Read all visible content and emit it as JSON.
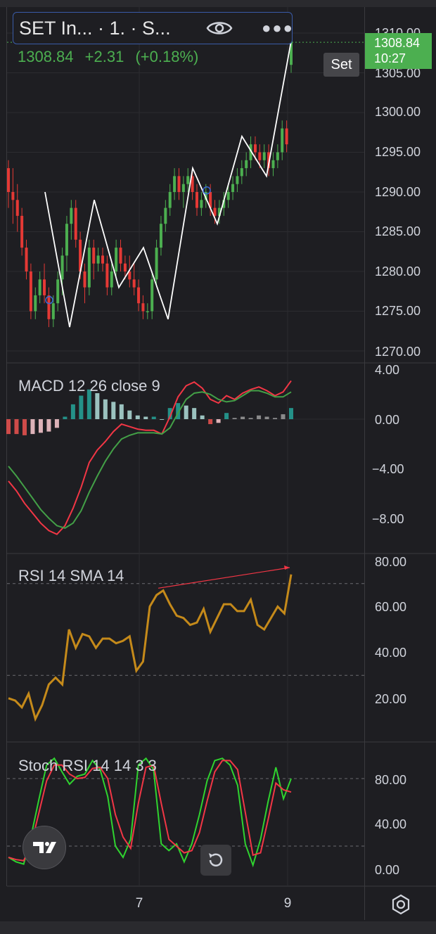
{
  "header": {
    "symbol_title": "SET In... · 1. · S...",
    "eye_icon": "eye-icon",
    "more_icon": "more-dots-icon"
  },
  "quote": {
    "last": "1308.84",
    "change": "+2.31",
    "change_pct": "(+0.18%)"
  },
  "price_tag": {
    "price": "1308.84",
    "countdown": "10:27"
  },
  "set_button": "Set",
  "price_axis": [
    "1310.00",
    "1305.00",
    "1300.00",
    "1295.00",
    "1290.00",
    "1285.00",
    "1280.00",
    "1275.00",
    "1270.00"
  ],
  "macd": {
    "label": "MACD 12 26 close 9",
    "axis": [
      "4.00",
      "0.00",
      "−4.00",
      "−8.00"
    ]
  },
  "rsi": {
    "label": "RSI 14 SMA 14",
    "axis": [
      "80.00",
      "60.00",
      "40.00",
      "20.00"
    ]
  },
  "stoch": {
    "label": "Stoch RSI 14 14 3 3",
    "axis": [
      "80.00",
      "40.00",
      "0.00"
    ]
  },
  "time_axis": [
    "7",
    "9"
  ],
  "colors": {
    "background": "#1e1e22",
    "up": "#4caf50",
    "down": "#e53935",
    "macd_line": "#f23645",
    "signal_line": "#43a047",
    "rsi_line": "#c58a1a",
    "stoch_k": "#2fd32f",
    "stoch_d": "#f23645",
    "zigzag": "#ffffff",
    "header_border": "#3a5ba8"
  },
  "icons": {
    "logo": "tradingview-logo-icon",
    "reset": "reset-chart-icon",
    "settings": "gear-icon"
  },
  "chart_data": [
    {
      "type": "candlestick",
      "title": "SET Index",
      "ylim": [
        1268,
        1313
      ],
      "y_ticks": [
        1270,
        1275,
        1280,
        1285,
        1290,
        1295,
        1300,
        1305,
        1310
      ],
      "x_ticks": [
        "7",
        "9"
      ],
      "zigzag": [
        1290,
        1273,
        1289,
        1278,
        1283,
        1274,
        1293,
        1286,
        1297,
        1292,
        1309
      ],
      "last_price": 1308.84,
      "candles": [
        [
          1293,
          1294,
          1288,
          1290
        ],
        [
          1290,
          1293,
          1286,
          1289
        ],
        [
          1289,
          1291,
          1285,
          1287
        ],
        [
          1287,
          1288,
          1282,
          1283
        ],
        [
          1283,
          1284,
          1279,
          1280
        ],
        [
          1280,
          1281,
          1274,
          1275
        ],
        [
          1275,
          1278,
          1274,
          1277
        ],
        [
          1277,
          1280,
          1276,
          1279
        ],
        [
          1279,
          1281,
          1276,
          1277
        ],
        [
          1277,
          1278,
          1273,
          1274
        ],
        [
          1274,
          1277,
          1273,
          1276
        ],
        [
          1276,
          1280,
          1275,
          1279
        ],
        [
          1279,
          1283,
          1277,
          1282
        ],
        [
          1282,
          1287,
          1280,
          1286
        ],
        [
          1286,
          1289,
          1284,
          1288
        ],
        [
          1288,
          1289,
          1283,
          1284
        ],
        [
          1284,
          1285,
          1279,
          1280
        ],
        [
          1280,
          1281,
          1276,
          1278
        ],
        [
          1278,
          1284,
          1277,
          1283
        ],
        [
          1283,
          1284,
          1279,
          1281
        ],
        [
          1281,
          1283,
          1280,
          1282
        ],
        [
          1282,
          1283,
          1280,
          1281
        ],
        [
          1281,
          1282,
          1277,
          1278
        ],
        [
          1278,
          1281,
          1277,
          1280
        ],
        [
          1280,
          1284,
          1279,
          1283
        ],
        [
          1283,
          1284,
          1280,
          1281
        ],
        [
          1281,
          1282,
          1279,
          1280
        ],
        [
          1280,
          1282,
          1278,
          1279
        ],
        [
          1279,
          1281,
          1277,
          1278
        ],
        [
          1278,
          1279,
          1275,
          1276
        ],
        [
          1276,
          1277,
          1274,
          1275
        ],
        [
          1275,
          1276,
          1274,
          1275
        ],
        [
          1275,
          1280,
          1274,
          1279
        ],
        [
          1279,
          1284,
          1278,
          1283
        ],
        [
          1283,
          1287,
          1282,
          1286
        ],
        [
          1286,
          1289,
          1285,
          1288
        ],
        [
          1288,
          1291,
          1287,
          1290
        ],
        [
          1290,
          1293,
          1289,
          1292
        ],
        [
          1292,
          1293,
          1289,
          1290
        ],
        [
          1290,
          1292,
          1288,
          1291
        ],
        [
          1291,
          1293,
          1290,
          1292
        ],
        [
          1292,
          1293,
          1289,
          1290
        ],
        [
          1290,
          1291,
          1287,
          1288
        ],
        [
          1288,
          1290,
          1287,
          1289
        ],
        [
          1289,
          1291,
          1288,
          1290
        ],
        [
          1290,
          1291,
          1287,
          1288
        ],
        [
          1288,
          1289,
          1286,
          1287
        ],
        [
          1287,
          1289,
          1286,
          1288
        ],
        [
          1288,
          1290,
          1287,
          1289
        ],
        [
          1289,
          1291,
          1288,
          1290
        ],
        [
          1290,
          1292,
          1289,
          1291
        ],
        [
          1291,
          1293,
          1290,
          1292
        ],
        [
          1292,
          1294,
          1291,
          1293
        ],
        [
          1293,
          1295,
          1292,
          1294
        ],
        [
          1294,
          1297,
          1293,
          1296
        ],
        [
          1296,
          1297,
          1294,
          1295
        ],
        [
          1295,
          1296,
          1293,
          1294
        ],
        [
          1294,
          1296,
          1293,
          1295
        ],
        [
          1295,
          1296,
          1292,
          1293
        ],
        [
          1293,
          1295,
          1292,
          1294
        ],
        [
          1294,
          1296,
          1293,
          1295
        ],
        [
          1295,
          1299,
          1294,
          1298
        ],
        [
          1298,
          1299,
          1295,
          1296
        ],
        [
          1306,
          1310,
          1305,
          1309
        ]
      ]
    },
    {
      "type": "line",
      "title": "MACD 12 26 close 9",
      "ylim": [
        -10.5,
        5.5
      ],
      "series": [
        {
          "name": "MACD",
          "values": [
            -5.0,
            -5.8,
            -6.8,
            -7.6,
            -8.4,
            -9.0,
            -9.3,
            -8.6,
            -7.2,
            -5.5,
            -3.5,
            -2.5,
            -1.8,
            -1.0,
            -0.4,
            -0.6,
            -0.8,
            -0.9,
            -0.9,
            -1.2,
            0.2,
            1.8,
            2.7,
            3.0,
            2.5,
            1.6,
            1.3,
            1.9,
            1.6,
            2.1,
            2.4,
            2.6,
            2.3,
            1.9,
            2.2,
            3.1
          ]
        },
        {
          "name": "Signal",
          "values": [
            -3.8,
            -4.6,
            -5.5,
            -6.4,
            -7.3,
            -8.0,
            -8.6,
            -8.8,
            -8.4,
            -7.4,
            -5.9,
            -4.6,
            -3.4,
            -2.4,
            -1.6,
            -1.3,
            -1.1,
            -1.1,
            -1.1,
            -1.2,
            -0.7,
            0.5,
            1.6,
            2.1,
            2.2,
            2.0,
            1.6,
            1.4,
            1.5,
            1.9,
            2.3,
            2.3,
            2.1,
            1.8,
            1.8,
            2.2
          ]
        }
      ],
      "histogram": [
        -1.2,
        -1.2,
        -1.3,
        -1.2,
        -1.1,
        -1.0,
        -0.7,
        0.2,
        1.2,
        1.9,
        2.4,
        2.1,
        1.6,
        1.4,
        1.2,
        0.7,
        0.3,
        0.2,
        0.2,
        0.0,
        0.9,
        1.3,
        1.1,
        0.9,
        0.3,
        -0.4,
        -0.3,
        0.5,
        0.1,
        0.2,
        0.1,
        0.3,
        0.2,
        0.1,
        0.4,
        0.9
      ]
    },
    {
      "type": "line",
      "title": "RSI 14 SMA 14",
      "ylim": [
        0,
        80
      ],
      "y_ticks": [
        20,
        40,
        60,
        80
      ],
      "bands": [
        70,
        30
      ],
      "series": [
        {
          "name": "RSI",
          "values": [
            20,
            19,
            16,
            22,
            11,
            17,
            26,
            29,
            26,
            50,
            42,
            48,
            47,
            42,
            46,
            46,
            44,
            45,
            47,
            32,
            36,
            60,
            65,
            67,
            61,
            56,
            55,
            52,
            53,
            59,
            49,
            55,
            61,
            61,
            58,
            58,
            63,
            52,
            50,
            55,
            60,
            57,
            74
          ]
        }
      ],
      "divergence": [
        [
          68,
          77
        ]
      ]
    },
    {
      "type": "line",
      "title": "Stoch RSI 14 14 3 3",
      "ylim": [
        -8,
        104
      ],
      "y_ticks": [
        0,
        40,
        80
      ],
      "bands": [
        80,
        20
      ],
      "series": [
        {
          "name": "K",
          "values": [
            10,
            6,
            4,
            30,
            62,
            92,
            98,
            86,
            75,
            82,
            84,
            96,
            88,
            64,
            20,
            10,
            26,
            92,
            98,
            88,
            22,
            16,
            22,
            6,
            22,
            48,
            78,
            96,
            98,
            92,
            74,
            22,
            3,
            26,
            60,
            90,
            62,
            80
          ]
        },
        {
          "name": "D",
          "values": [
            10,
            8,
            7,
            22,
            50,
            78,
            92,
            92,
            84,
            80,
            81,
            89,
            90,
            80,
            48,
            28,
            18,
            58,
            90,
            92,
            58,
            26,
            20,
            14,
            16,
            32,
            60,
            86,
            96,
            96,
            88,
            50,
            12,
            14,
            44,
            76,
            70,
            68
          ]
        }
      ]
    }
  ]
}
